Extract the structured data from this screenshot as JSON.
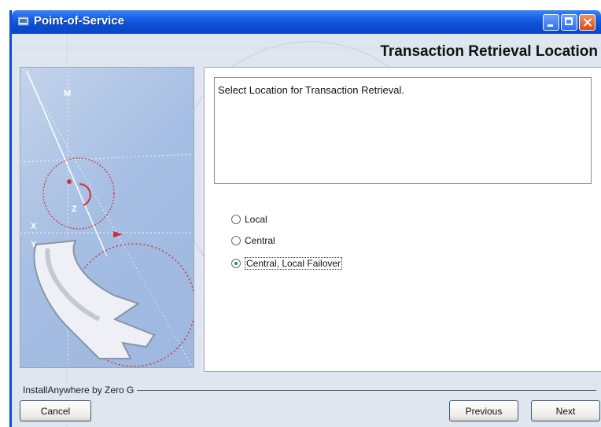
{
  "window": {
    "title": "Point-of-Service",
    "page_heading": "Transaction Retrieval Location"
  },
  "message": "Select Location for Transaction Retrieval.",
  "options": [
    {
      "label": "Local",
      "selected": false
    },
    {
      "label": "Central",
      "selected": false
    },
    {
      "label": "Central, Local Failover",
      "selected": true
    }
  ],
  "footer": {
    "vendor_label": "InstallAnywhere by Zero G",
    "cancel_label": "Cancel",
    "previous_label": "Previous",
    "next_label": "Next"
  },
  "illustration": {
    "letters": [
      "M",
      "Z",
      "X",
      "Y"
    ],
    "icon": "wrench-icon"
  },
  "colors": {
    "title_bar": "#0a47c4",
    "window_bg": "#dfe6ef",
    "accent_dotted": "#d0303e",
    "selected_radio": "#2f8a2f"
  }
}
